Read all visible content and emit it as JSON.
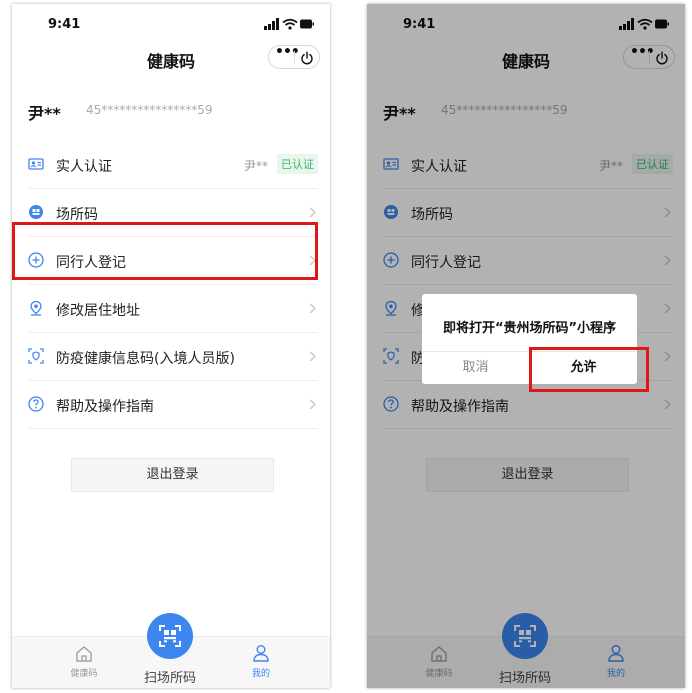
{
  "status_bar": {
    "time": "9:41"
  },
  "nav": {
    "title": "健康码",
    "more_label": "•••"
  },
  "user": {
    "name": "尹**",
    "id_masked": "45****************59"
  },
  "menu": [
    {
      "id": "realname",
      "label": "实人认证",
      "icon": "id-card-icon",
      "masked_name": "尹**",
      "badge": "已认证"
    },
    {
      "id": "venue",
      "label": "场所码",
      "icon": "venue-code-icon"
    },
    {
      "id": "companion",
      "label": "同行人登记",
      "icon": "add-circle-icon"
    },
    {
      "id": "address",
      "label": "修改居住地址",
      "icon": "location-pin-icon"
    },
    {
      "id": "entry",
      "label": "防疫健康信息码(入境人员版)",
      "icon": "shield-scan-icon"
    },
    {
      "id": "help",
      "label": "帮助及操作指南",
      "icon": "question-circle-icon"
    }
  ],
  "logout_label": "退出登录",
  "tabbar": {
    "home_label": "健康码",
    "scan_label": "扫场所码",
    "me_label": "我的"
  },
  "dialog": {
    "message": "即将打开“贵州场所码”小程序",
    "cancel_label": "取消",
    "allow_label": "允许"
  },
  "colors": {
    "accent": "#3d86f0",
    "highlight": "#e01717",
    "verified_green": "#3cb371"
  }
}
